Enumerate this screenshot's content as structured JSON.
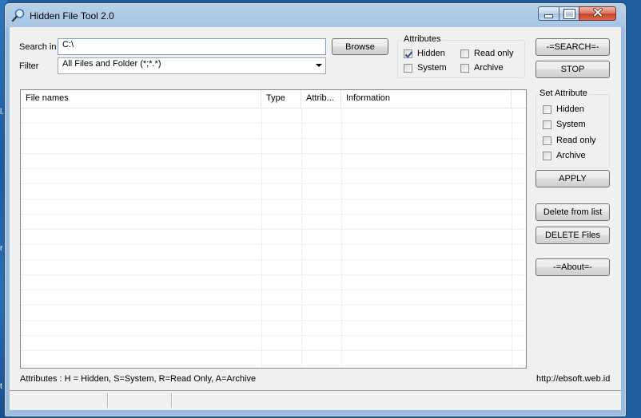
{
  "window": {
    "title": "Hidden File Tool 2.0"
  },
  "search": {
    "search_in_label": "Search in",
    "path_value": "C:\\",
    "browse_label": "Browse",
    "filter_label": "Filter",
    "filter_value": "All Files and Folder (*;*.*)"
  },
  "attributes": {
    "title": "Attributes",
    "items": [
      {
        "label": "Hidden",
        "checked": true
      },
      {
        "label": "Read only",
        "checked": false
      },
      {
        "label": "System",
        "checked": false
      },
      {
        "label": "Archive",
        "checked": false
      }
    ]
  },
  "actions": {
    "search_label": "-=SEARCH=-",
    "stop_label": "STOP",
    "apply_label": "APPLY",
    "delete_from_list_label": "Delete from list",
    "delete_files_label": "DELETE Files",
    "about_label": "-=About=-"
  },
  "set_attribute": {
    "title": "Set Attribute",
    "items": [
      {
        "label": "Hidden",
        "checked": false
      },
      {
        "label": "System",
        "checked": false
      },
      {
        "label": "Read only",
        "checked": false
      },
      {
        "label": "Archive",
        "checked": false
      }
    ]
  },
  "file_list": {
    "columns": [
      "File names",
      "Type",
      "Attrib...",
      "Information"
    ],
    "rows": []
  },
  "footer": {
    "legend": "Attributes : H = Hidden, S=System, R=Read Only, A=Archive",
    "url": "http://ebsoft.web.id"
  },
  "desktop": {
    "glyphs": [
      "l.",
      "r",
      "t"
    ]
  },
  "colors": {
    "desktop": "#1f5d9e",
    "window_frame": "#a6c4e4",
    "close_button": "#c7402a"
  }
}
